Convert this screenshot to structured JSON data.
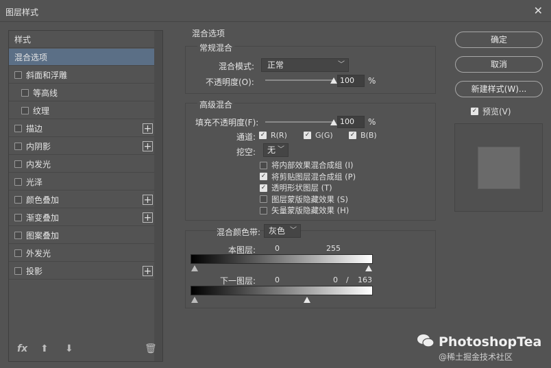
{
  "window": {
    "title": "图层样式",
    "close_glyph": "✕"
  },
  "styles_list": {
    "header": "样式",
    "items": [
      {
        "label": "混合选项",
        "checkbox": false,
        "selected": true,
        "plus": false,
        "indent": false
      },
      {
        "label": "斜面和浮雕",
        "checkbox": true,
        "selected": false,
        "plus": false,
        "indent": false
      },
      {
        "label": "等高线",
        "checkbox": true,
        "selected": false,
        "plus": false,
        "indent": true
      },
      {
        "label": "纹理",
        "checkbox": true,
        "selected": false,
        "plus": false,
        "indent": true
      },
      {
        "label": "描边",
        "checkbox": true,
        "selected": false,
        "plus": true,
        "indent": false
      },
      {
        "label": "内阴影",
        "checkbox": true,
        "selected": false,
        "plus": true,
        "indent": false
      },
      {
        "label": "内发光",
        "checkbox": true,
        "selected": false,
        "plus": false,
        "indent": false
      },
      {
        "label": "光泽",
        "checkbox": true,
        "selected": false,
        "plus": false,
        "indent": false
      },
      {
        "label": "颜色叠加",
        "checkbox": true,
        "selected": false,
        "plus": true,
        "indent": false
      },
      {
        "label": "渐变叠加",
        "checkbox": true,
        "selected": false,
        "plus": true,
        "indent": false
      },
      {
        "label": "图案叠加",
        "checkbox": true,
        "selected": false,
        "plus": false,
        "indent": false
      },
      {
        "label": "外发光",
        "checkbox": true,
        "selected": false,
        "plus": false,
        "indent": false
      },
      {
        "label": "投影",
        "checkbox": true,
        "selected": false,
        "plus": true,
        "indent": false
      }
    ],
    "bottom": {
      "fx": "fx",
      "up": "⬆",
      "down": "⬇",
      "trash": "🗑"
    }
  },
  "blending": {
    "section_title": "混合选项",
    "general": {
      "title": "常规混合",
      "mode_label": "混合模式:",
      "mode_value": "正常",
      "opacity_label": "不透明度(O):",
      "opacity_value": "100",
      "opacity_fraction": 1.0,
      "percent": "%"
    },
    "advanced": {
      "title": "高级混合",
      "fill_label": "填充不透明度(F):",
      "fill_value": "100",
      "fill_fraction": 1.0,
      "percent": "%",
      "channels_label": "通道:",
      "channels": [
        {
          "label": "R(R)",
          "checked": true
        },
        {
          "label": "G(G)",
          "checked": true
        },
        {
          "label": "B(B)",
          "checked": true
        }
      ],
      "knockout_label": "挖空:",
      "knockout_value": "无",
      "options": [
        {
          "label": "将内部效果混合成组 (I)",
          "checked": false
        },
        {
          "label": "将剪贴图层混合成组 (P)",
          "checked": true
        },
        {
          "label": "透明形状图层 (T)",
          "checked": true
        },
        {
          "label": "图层蒙版隐藏效果 (S)",
          "checked": false
        },
        {
          "label": "矢量蒙版隐藏效果 (H)",
          "checked": false
        }
      ]
    },
    "blend_if": {
      "label": "混合颜色带:",
      "value": "灰色",
      "this_layer_label": "本图层:",
      "this_layer_low": "0",
      "this_layer_high": "255",
      "underlying_label": "下一图层:",
      "underlying_low": "0",
      "underlying_mid": "0",
      "underlying_sep": "/",
      "underlying_high": "163"
    }
  },
  "buttons": {
    "ok": "确定",
    "cancel": "取消",
    "new_style": "新建样式(W)...",
    "preview_label": "预览(V)",
    "preview_checked": true
  },
  "watermark": {
    "brand": "PhotoshopTea",
    "sub": "@稀土掘金技术社区"
  }
}
